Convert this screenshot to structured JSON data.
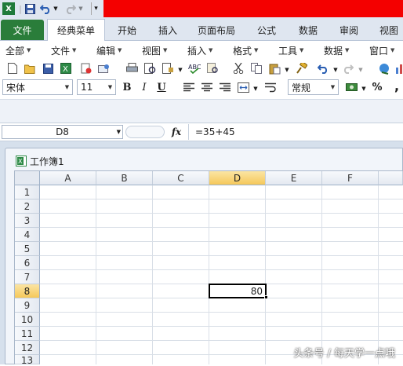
{
  "quick_access": {
    "excel_icon": "excel-logo-icon",
    "save_icon": "save-icon",
    "undo_icon": "undo-icon",
    "redo_icon": "redo-icon",
    "customize_icon": "customize-qat-icon"
  },
  "ribbon_tabs": [
    "文件",
    "经典菜单",
    "开始",
    "插入",
    "页面布局",
    "公式",
    "数据",
    "审阅",
    "视图"
  ],
  "menubar": [
    "全部",
    "文件",
    "编辑",
    "视图",
    "插入",
    "格式",
    "工具",
    "数据",
    "窗口"
  ],
  "toolbar": {
    "font_name": "宋体",
    "font_size": "11",
    "bold": "B",
    "italic": "I",
    "underline": "U",
    "number_format": "常规",
    "percent": "%",
    "comma": ","
  },
  "formula_bar": {
    "name_box": "D8",
    "fx_label": "fx",
    "formula": "=35+45"
  },
  "workbook": {
    "title": "工作簿1",
    "columns": [
      "A",
      "B",
      "C",
      "D",
      "E",
      "F"
    ],
    "rows": [
      "1",
      "2",
      "3",
      "4",
      "5",
      "6",
      "7",
      "8",
      "9",
      "10",
      "11",
      "12",
      "13"
    ],
    "selected_column": "D",
    "selected_row": "8",
    "selected_cell_value": "80"
  },
  "watermark": "头条号 / 每天学一点哦",
  "colors": {
    "file_tab": "#2a7d3a",
    "title_red": "#f40000",
    "selection_header": "#f5c85a"
  }
}
